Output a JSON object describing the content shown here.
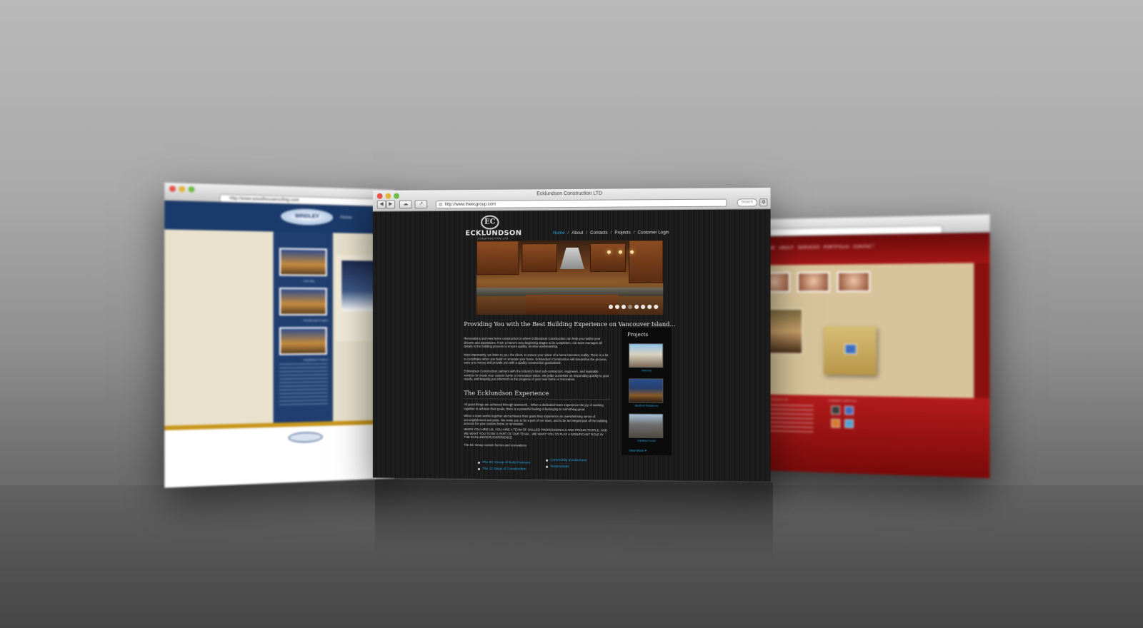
{
  "center_window": {
    "window_title": "Ecklundson Construction LTD",
    "url": "http://www.theecgroup.com",
    "search_placeholder": "Search",
    "back_label": "◀",
    "forward_label": "▶",
    "logo": {
      "monogram": "EC",
      "name": "ECKLUNDSON",
      "subtitle": "CONSTRUCTION LTD."
    },
    "nav": [
      {
        "label": "Home",
        "active": true
      },
      {
        "label": "About",
        "active": false
      },
      {
        "label": "Contacts",
        "active": false
      },
      {
        "label": "Projects",
        "active": false
      },
      {
        "label": "Customer Login",
        "active": false
      }
    ],
    "nav_separator": "/",
    "slider": {
      "dot_count": 8,
      "active_index": 3
    },
    "tagline": "Providing You with the Best Building Experience on Vancouver Island...",
    "paragraphs": [
      "Renovations and new home construction is where Ecklundson Construction can help you realize your dreams and aspirations. From a home's very beginning stages to its completion, our team manages all details in the building process to ensure quality, on-time workmanship.",
      "Most importantly, we listen to you, the client, to ensure your vision of a home becomes reality. There is a lot to coordinate when you build or renovate your home. Ecklundson Construction will streamline the process, save you money and provide you with a quality construction guaranteed.",
      "Ecklundson Construction partners with the industry's best sub-contractors, engineers, and reputable vendors to create your custom home or renovation vision. We pride ourselves on responding quickly to your needs, and keeping you informed on the progress of your new home or renovation."
    ],
    "experience_heading": "The Ecklundson Experience",
    "experience_paragraphs": [
      "All great things are achieved through teamwork... When a dedicated team experience the joy of working together to achieve their goals, there is a powerful feeling of belonging to something great.",
      "When a team works together and achieves their goals they experience an overwhelming sense of accomplishment and pride. We invite you to be a part of our team, and to be an integral part of the building process for your custom home or renovation.",
      "WHEN YOU HIRE US, YOU HIRE A TEAM OF SKILLED PROFESSIONALS AND PROUD PEOPLE, AND WE WANT YOU TO BE A PART OF OUR TEAM... WE WANT YOU TO PLAY A SIGNIFICANT ROLE IN THE ECKLUNDSON EXPERIENCE.",
      "The EC Group custom homes and renovations"
    ],
    "sidebar": {
      "title": "Projects",
      "items": [
        {
          "caption": "Balcony"
        },
        {
          "caption": "Bedford Residence"
        },
        {
          "caption": "Fairfield Condo"
        }
      ],
      "view_all": "View More"
    },
    "footer_links_left": [
      "The EC Group of Build Partners",
      "The 12 Steps of Construction"
    ],
    "footer_links_right": [
      "Community Involvement",
      "Testimonials"
    ]
  },
  "left_window": {
    "url": "http://www.woodhouseroofing.com",
    "logo_text": "WINDLEY",
    "nav_item": "Home",
    "thumb_captions": [
      "Oak Bay",
      "Residential Project",
      "Installation Project"
    ]
  },
  "right_window": {
    "nav_items": [
      "HOME",
      "ABOUT",
      "SERVICES",
      "PORTFOLIO",
      "CONTACT"
    ],
    "footer_heading_left": "CONTACT US",
    "footer_heading_right": "CONNECT WITH US"
  },
  "colors": {
    "accent_blue": "#27a7e3",
    "left_brand": "#1a3a6b",
    "left_gold": "#c8961c",
    "right_red": "#a51616",
    "center_bg": "#1b1b1b"
  }
}
